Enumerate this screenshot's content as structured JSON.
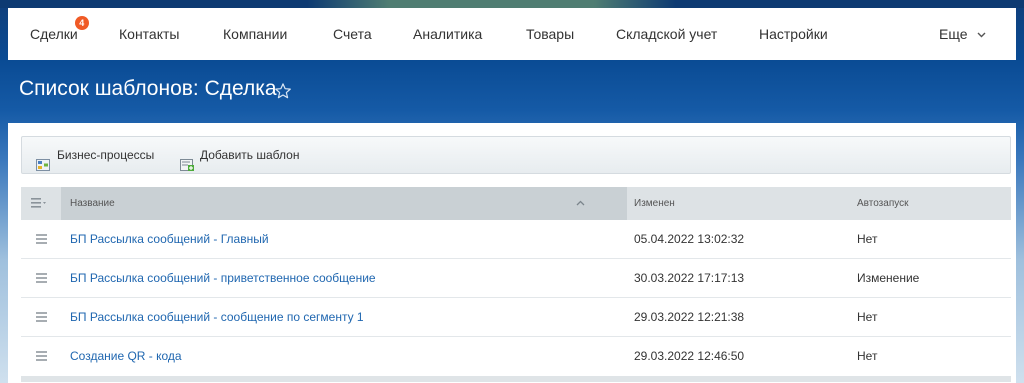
{
  "nav": {
    "items": [
      {
        "label": "Сделки",
        "badge": "4"
      },
      {
        "label": "Контакты"
      },
      {
        "label": "Компании"
      },
      {
        "label": "Счета"
      },
      {
        "label": "Аналитика"
      },
      {
        "label": "Товары"
      },
      {
        "label": "Складской учет"
      },
      {
        "label": "Настройки"
      }
    ],
    "more_label": "Еще"
  },
  "page": {
    "title": "Список шаблонов: Сделка"
  },
  "toolbar": {
    "business_processes_label": "Бизнес-процессы",
    "add_template_label": "Добавить шаблон"
  },
  "grid": {
    "columns": {
      "name": "Название",
      "modified": "Изменен",
      "autostart": "Автозапуск"
    },
    "rows": [
      {
        "name": "БП Рассылка сообщений - Главный",
        "modified": "05.04.2022 13:02:32",
        "autostart": "Нет"
      },
      {
        "name": "БП Рассылка сообщений - приветственное сообщение",
        "modified": "30.03.2022 17:17:13",
        "autostart": "Изменение"
      },
      {
        "name": "БП Рассылка сообщений - сообщение по сегменту 1",
        "modified": "29.03.2022 12:21:38",
        "autostart": "Нет"
      },
      {
        "name": "Создание QR - кода",
        "modified": "29.03.2022 12:46:50",
        "autostart": "Нет"
      }
    ]
  },
  "colors": {
    "accent": "#2067b0",
    "badge": "#f05a25",
    "header_bg": "#0a4b94"
  }
}
